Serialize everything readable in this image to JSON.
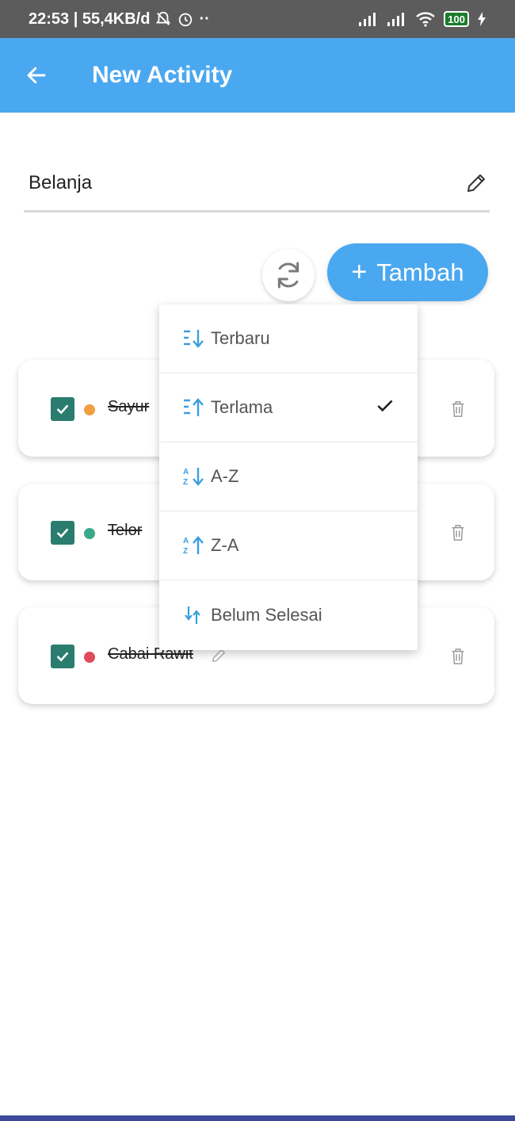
{
  "status_bar": {
    "time_info": "22:53 | 55,4KB/d",
    "battery": "100"
  },
  "app_bar": {
    "title": "New Activity"
  },
  "activity": {
    "name": "Belanja"
  },
  "actions": {
    "add_label": "Tambah"
  },
  "items": [
    {
      "label": "Sayur",
      "color": "#f0a040",
      "checked": true
    },
    {
      "label": "Telor",
      "color": "#3aa88a",
      "checked": true
    },
    {
      "label": "Cabai Rawit",
      "color": "#e04a5a",
      "checked": true
    }
  ],
  "sort_menu": {
    "options": [
      {
        "label": "Terbaru",
        "icon": "sort-newest-icon",
        "selected": false
      },
      {
        "label": "Terlama",
        "icon": "sort-oldest-icon",
        "selected": true
      },
      {
        "label": "A-Z",
        "icon": "sort-az-icon",
        "selected": false
      },
      {
        "label": "Z-A",
        "icon": "sort-za-icon",
        "selected": false
      },
      {
        "label": "Belum Selesai",
        "icon": "sort-unfinished-icon",
        "selected": false
      }
    ]
  },
  "colors": {
    "primary": "#4aa8f0",
    "checkbox": "#2a7d6e",
    "icon_accent": "#3a9ee0"
  }
}
